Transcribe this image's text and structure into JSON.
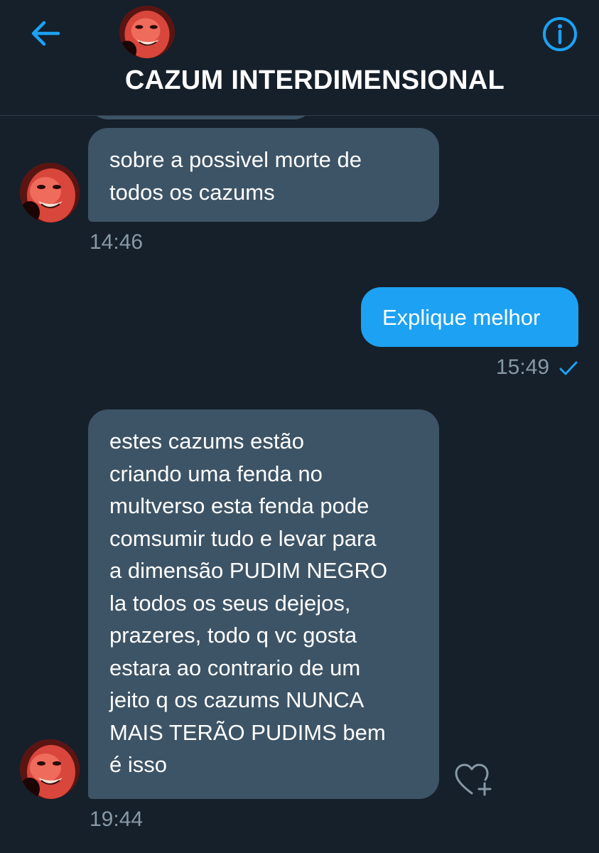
{
  "header": {
    "title": "CAZUM INTERDIMENSIONAL",
    "back_icon": "arrow-left-icon",
    "info_icon": "info-circle-icon",
    "avatar": "contact-avatar"
  },
  "messages": [
    {
      "direction": "received",
      "lines": [
        "sobre a possivel morte de",
        "todos os cazums"
      ],
      "time": "14:46"
    },
    {
      "direction": "sent",
      "lines": [
        "Explique melhor"
      ],
      "time": "15:49",
      "status_icon": "checkmark-icon"
    },
    {
      "direction": "received",
      "lines": [
        "estes cazums estão",
        "criando uma fenda no",
        "multverso esta fenda pode",
        "comsumir tudo e levar para",
        "a dimensão PUDIM NEGRO",
        "la todos os seus dejejos,",
        "prazeres, todo q vc gosta",
        "estara ao contrario de um",
        "jeito q os cazums NUNCA",
        "MAIS TERÃO PUDIMS bem",
        "é isso"
      ],
      "time": "19:44",
      "reaction_icon": "heart-add-icon"
    }
  ],
  "colors": {
    "background": "#15202b",
    "received_bubble": "#3d5466",
    "sent_bubble": "#1da1f2",
    "accent": "#1da1f2",
    "timestamp": "#8899a6"
  }
}
